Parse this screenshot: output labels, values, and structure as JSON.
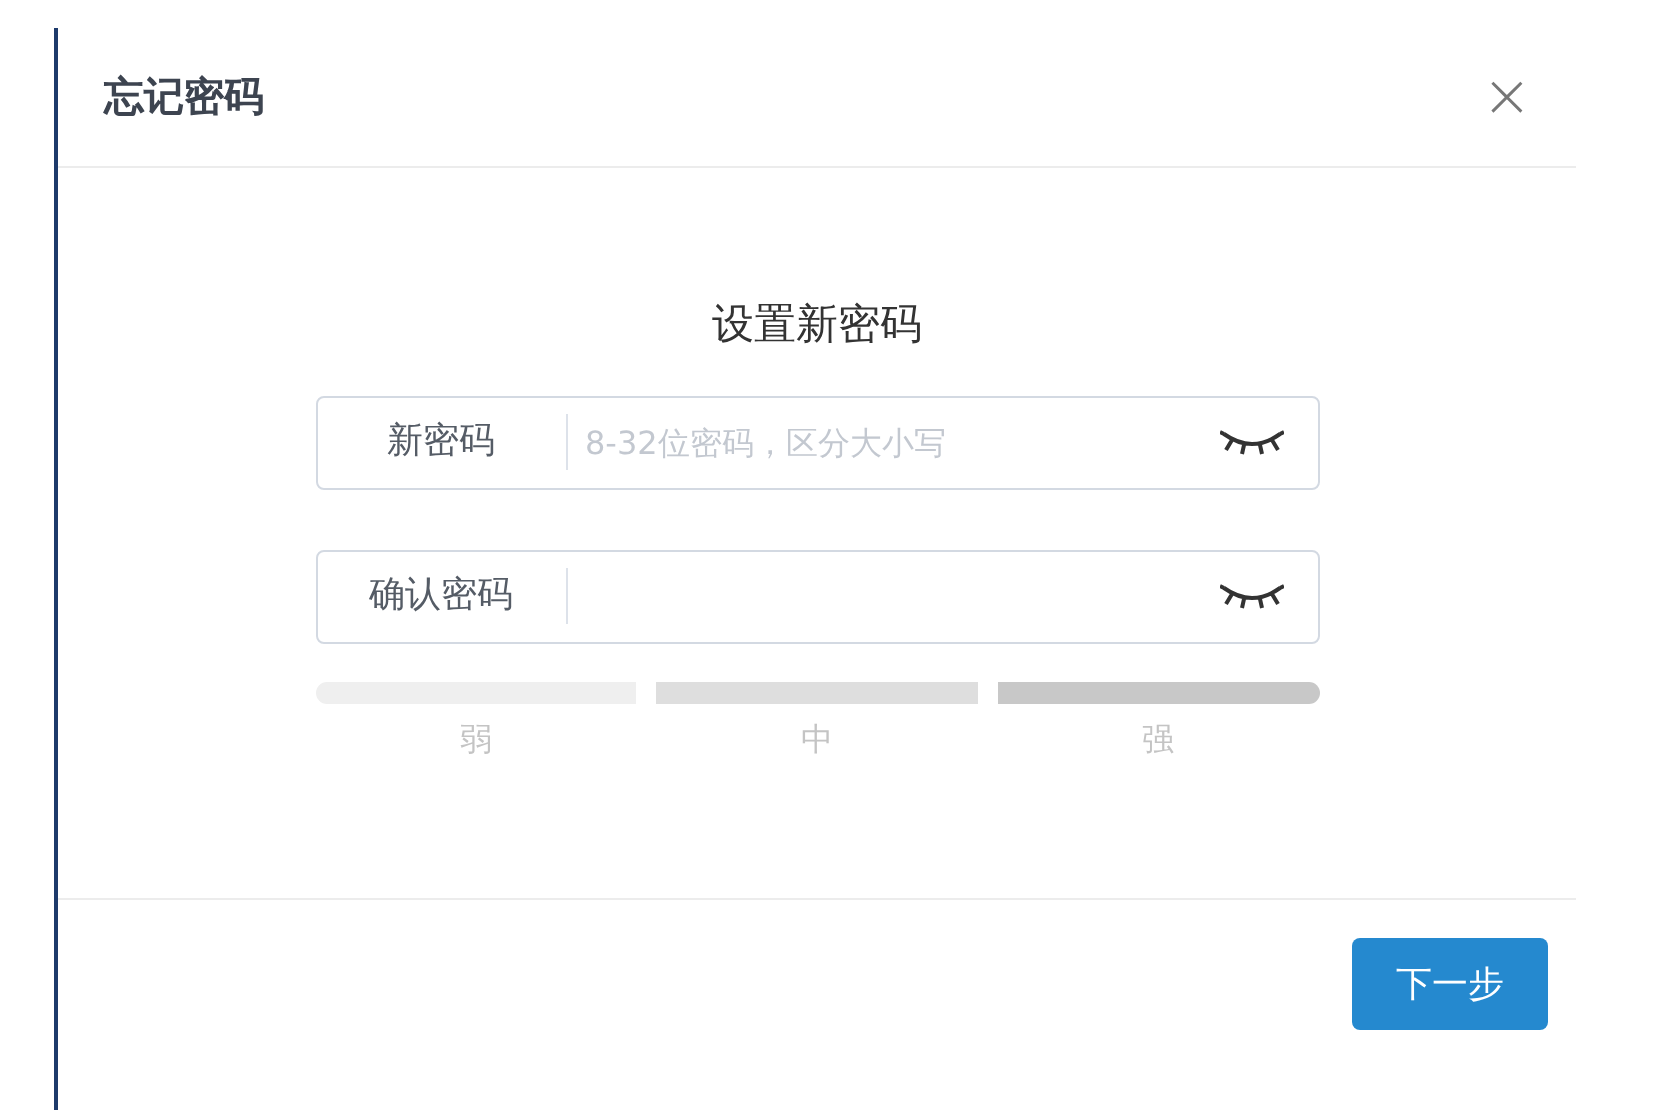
{
  "dialog": {
    "title": "忘记密码",
    "close": "×"
  },
  "heading": "设置新密码",
  "fields": [
    {
      "label": "新密码",
      "placeholder": "8-32位密码，区分大小写"
    },
    {
      "label": "确认密码"
    }
  ],
  "strength": [
    {
      "label": "弱",
      "color": "#efefef"
    },
    {
      "label": "中",
      "color": "#dedede"
    },
    {
      "label": "强",
      "color": "#c8c8c8"
    }
  ],
  "buttons": [
    {
      "label": "下一步"
    }
  ]
}
